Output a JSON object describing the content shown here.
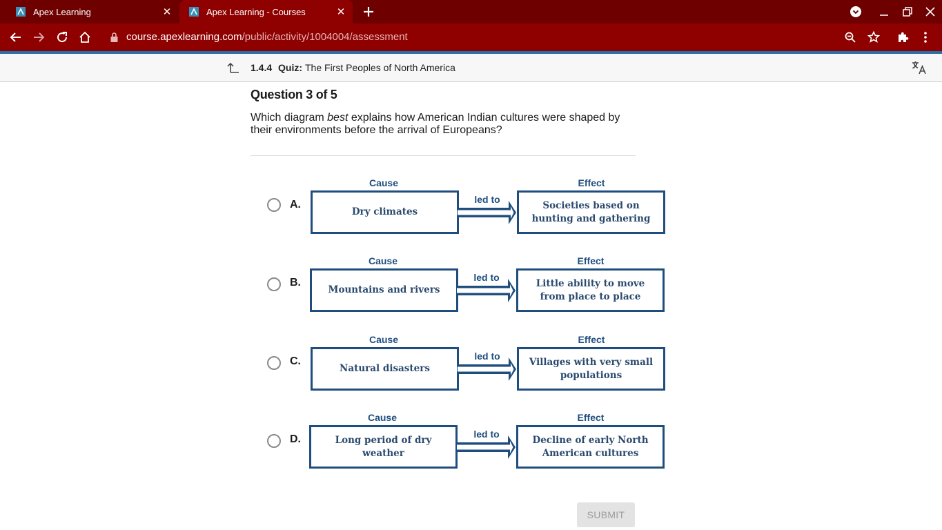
{
  "browser": {
    "tabs": [
      {
        "title": "Apex Learning"
      },
      {
        "title": "Apex Learning - Courses"
      }
    ],
    "url_host": "course.apexlearning.com",
    "url_path": "/public/activity/1004004/assessment"
  },
  "activity": {
    "number": "1.4.4",
    "type": "Quiz:",
    "title": "The First Peoples of North America"
  },
  "question": {
    "heading": "Question 3 of 5",
    "text_before": "Which diagram ",
    "text_emphasis": "best",
    "text_after": " explains how American Indian cultures were shaped by their environments before the arrival of Europeans?"
  },
  "labels": {
    "cause": "Cause",
    "effect": "Effect",
    "led_to": "led to"
  },
  "options": [
    {
      "letter": "A.",
      "cause": "Dry climates",
      "effect": "Societies based on hunting and gathering"
    },
    {
      "letter": "B.",
      "cause": "Mountains and rivers",
      "effect": "Little ability to move from place to place"
    },
    {
      "letter": "C.",
      "cause": "Natural disasters",
      "effect": "Villages with very small populations"
    },
    {
      "letter": "D.",
      "cause": "Long period of dry weather",
      "effect": "Decline of early North American cultures"
    }
  ],
  "submit_label": "SUBMIT",
  "colors": {
    "tabbar": "#6e0000",
    "toolbar": "#8f0000",
    "diagram": "#1f4e7e"
  }
}
